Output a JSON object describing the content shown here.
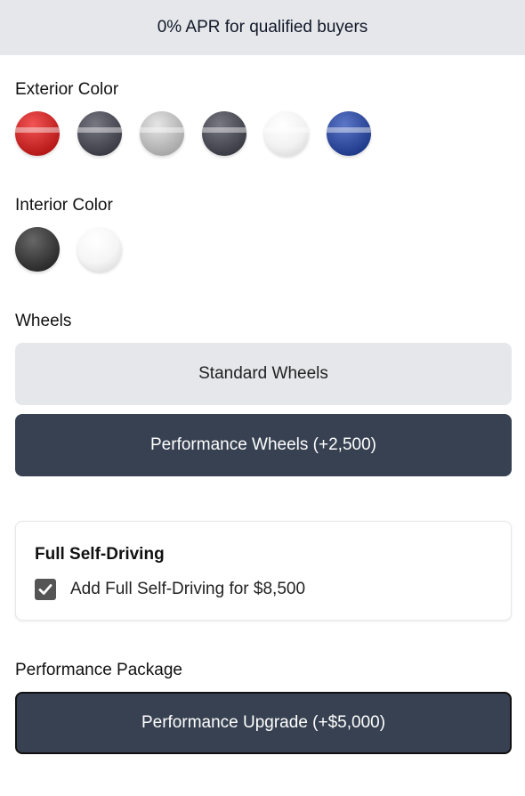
{
  "banner": {
    "text": "0% APR for qualified buyers"
  },
  "exterior": {
    "title": "Exterior Color",
    "swatches": [
      {
        "name": "red",
        "color": "#c62828"
      },
      {
        "name": "dark-gray",
        "color": "#4b4b55"
      },
      {
        "name": "silver",
        "color": "#b8b8b8"
      },
      {
        "name": "charcoal",
        "color": "#4b4b55"
      },
      {
        "name": "white",
        "color": "#f2f2f2"
      },
      {
        "name": "blue",
        "color": "#2f4a9a"
      }
    ]
  },
  "interior": {
    "title": "Interior Color",
    "swatches": [
      {
        "name": "black",
        "color": "#3a3a3a"
      },
      {
        "name": "white",
        "color": "#f5f5f5"
      }
    ]
  },
  "wheels": {
    "title": "Wheels",
    "options": [
      {
        "label": "Standard Wheels",
        "selected": false
      },
      {
        "label": "Performance Wheels (+2,500)",
        "selected": true
      }
    ]
  },
  "fsd": {
    "title": "Full Self-Driving",
    "checkbox_label": "Add Full Self-Driving for $8,500",
    "checked": true
  },
  "performance": {
    "title": "Performance Package",
    "button_label": "Performance Upgrade (+$5,000)"
  }
}
